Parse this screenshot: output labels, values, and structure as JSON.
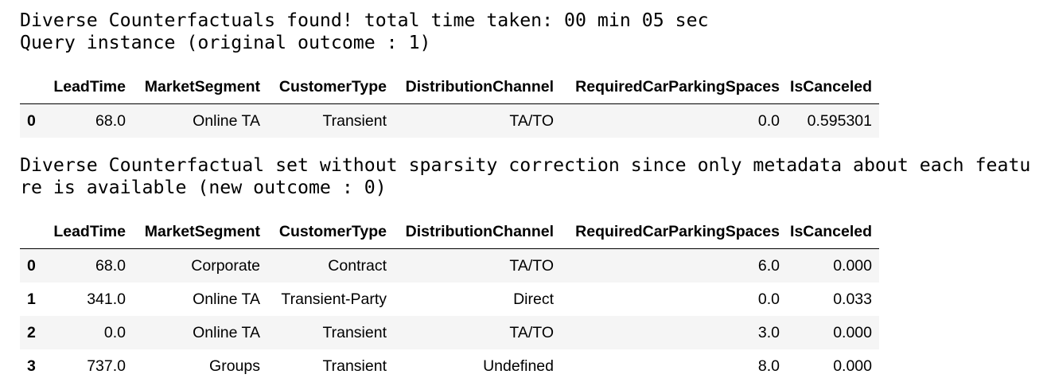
{
  "output": {
    "line1": "Diverse Counterfactuals found! total time taken: 00 min 05 sec",
    "line2": "Query instance (original outcome : 1)",
    "line3": "Diverse Counterfactual set without sparsity correction since only metadata about each featu",
    "line4": "re is available (new outcome : 0)"
  },
  "columns": [
    "LeadTime",
    "MarketSegment",
    "CustomerType",
    "DistributionChannel",
    "RequiredCarParkingSpaces",
    "IsCanceled"
  ],
  "query_table": {
    "rows": [
      {
        "index": "0",
        "cells": [
          "68.0",
          "Online TA",
          "Transient",
          "TA/TO",
          "0.0",
          "0.595301"
        ]
      }
    ]
  },
  "cf_table": {
    "rows": [
      {
        "index": "0",
        "cells": [
          "68.0",
          "Corporate",
          "Contract",
          "TA/TO",
          "6.0",
          "0.000"
        ]
      },
      {
        "index": "1",
        "cells": [
          "341.0",
          "Online TA",
          "Transient-Party",
          "Direct",
          "0.0",
          "0.033"
        ]
      },
      {
        "index": "2",
        "cells": [
          "0.0",
          "Online TA",
          "Transient",
          "TA/TO",
          "3.0",
          "0.000"
        ]
      },
      {
        "index": "3",
        "cells": [
          "737.0",
          "Groups",
          "Transient",
          "Undefined",
          "8.0",
          "0.000"
        ]
      }
    ]
  }
}
